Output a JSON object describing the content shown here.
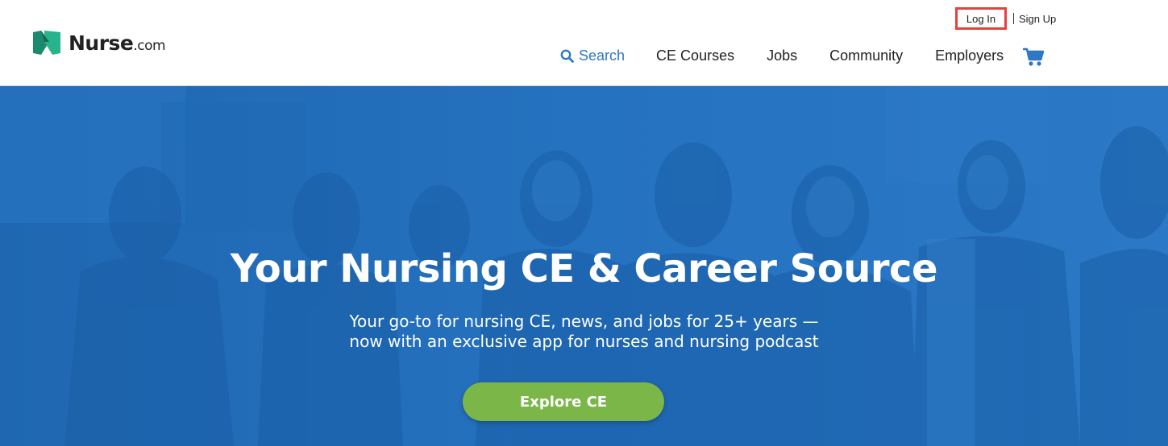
{
  "brand": {
    "name": "Nurse",
    "suffix": ".com",
    "mark_colors": [
      "#1c8a6e",
      "#27b48c"
    ]
  },
  "utility_nav": {
    "login_label": "Log In",
    "signup_label": "Sign Up",
    "highlight_color": "#e8403e"
  },
  "main_nav": {
    "items": [
      {
        "label": "Search",
        "icon": "search-icon"
      },
      {
        "label": "CE Courses"
      },
      {
        "label": "Jobs"
      },
      {
        "label": "Community"
      },
      {
        "label": "Employers"
      }
    ],
    "cart_icon": "cart-icon",
    "accent_color": "#2f78c4"
  },
  "hero": {
    "title": "Your Nursing CE & Career Source",
    "subtitle_line1": "Your go-to for nursing CE, news, and jobs for 25+ years —",
    "subtitle_line2": "now with an exclusive app for nurses and nursing podcast",
    "cta_label": "Explore CE",
    "overlay_color": "#2472c0",
    "cta_color": "#7ab648"
  }
}
